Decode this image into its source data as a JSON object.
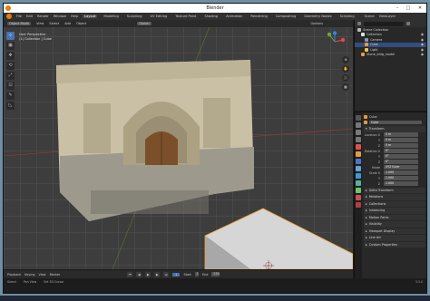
{
  "window": {
    "title": "Blender",
    "min": "–",
    "max": "□",
    "close": "✕"
  },
  "menubar": {
    "menus": [
      "File",
      "Edit",
      "Render",
      "Window",
      "Help"
    ],
    "workspaces": [
      "Layout",
      "Modeling",
      "Sculpting",
      "UV Editing",
      "Texture Paint",
      "Shading",
      "Animation",
      "Rendering",
      "Compositing",
      "Geometry Nodes",
      "Scripting"
    ],
    "active_workspace": "Layout",
    "scene": "Scene",
    "view_layer": "ViewLayer"
  },
  "viewport": {
    "header": {
      "mode": "Object Mode",
      "view": "View",
      "select": "Select",
      "add": "Add",
      "object": "Object",
      "transform": "Global",
      "options": "Options"
    },
    "info_line1": "User Perspective",
    "info_line2": "(1) Collection | Cube",
    "tools": [
      "⊹",
      "▣",
      "✥",
      "⟲",
      "⤢",
      "⊡",
      "✎",
      "◺"
    ],
    "nav": [
      "⊕",
      "✋",
      "🎥",
      "▦"
    ]
  },
  "outliner": {
    "items": [
      {
        "label": "Scene Collection",
        "selected": false,
        "color": "#bbbbbb"
      },
      {
        "label": "Collection",
        "selected": false,
        "color": "#e0e0e0"
      },
      {
        "label": "Camera",
        "selected": false,
        "color": "#7a9cc9"
      },
      {
        "label": "Cube",
        "selected": true,
        "color": "#e89a3c"
      },
      {
        "label": "Light",
        "selected": false,
        "color": "#e8c84a"
      },
      {
        "label": "Stone_bldg_model",
        "selected": false,
        "color": "#e89a3c"
      }
    ]
  },
  "properties": {
    "object_name": "Cube",
    "mesh_name": "Cube",
    "transform_label": "Transform",
    "location_label": "Location X",
    "loc": [
      "0 m",
      "0 m",
      "0 m"
    ],
    "rotation_label": "Rotation X",
    "rot": [
      "0°",
      "0°",
      "0°"
    ],
    "mode_label": "Mode",
    "mode_value": "XYZ Euler",
    "scale_label": "Scale X",
    "scale": [
      "1.000",
      "1.000",
      "1.000"
    ],
    "sections": [
      "Delta Transform",
      "Relations",
      "Collections",
      "Instancing",
      "Motion Paths",
      "Visibility",
      "Viewport Display",
      "Line Art",
      "Custom Properties"
    ]
  },
  "timeline": {
    "playback": "Playback",
    "keying": "Keying",
    "view": "View",
    "marker": "Marker",
    "current_frame": "1",
    "start_label": "Start",
    "start": "1",
    "end_label": "End",
    "end": "250"
  },
  "status": {
    "select": "Select",
    "pan": "Pan View",
    "context": "Set 3D Cursor",
    "version": "3.3.0"
  },
  "colors": {
    "accent": "#4772b3",
    "selection": "#334d80",
    "brand": "#e87d0d"
  }
}
